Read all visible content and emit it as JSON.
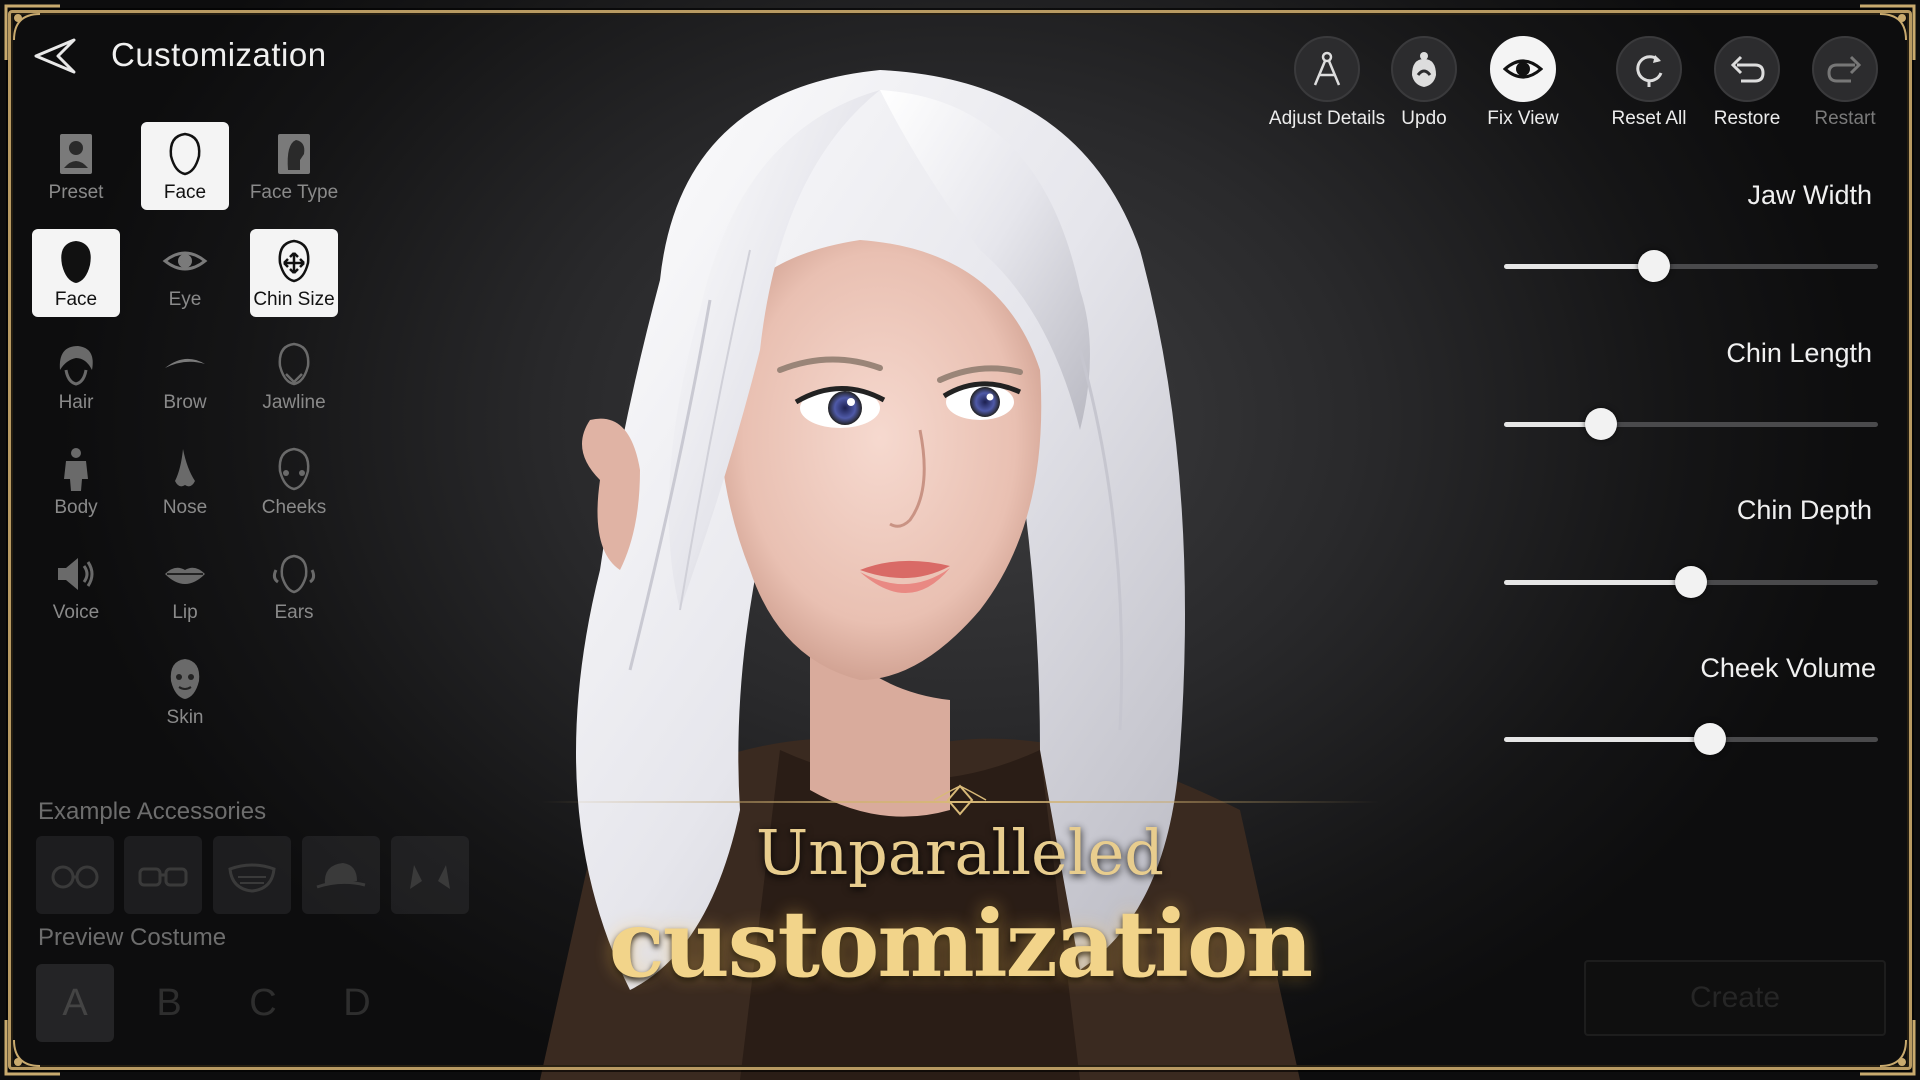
{
  "header": {
    "title": "Customization"
  },
  "categories": [
    {
      "key": "preset",
      "label": "Preset",
      "icon": "portrait-icon",
      "active": false
    },
    {
      "key": "face_tab",
      "label": "Face",
      "icon": "face-outline-icon",
      "active": true
    },
    {
      "key": "face_type",
      "label": "Face Type",
      "icon": "head-profile-icon",
      "active": false
    },
    {
      "key": "face",
      "label": "Face",
      "icon": "face-solid-icon",
      "active": true
    },
    {
      "key": "eye",
      "label": "Eye",
      "icon": "eye-icon",
      "active": false
    },
    {
      "key": "chin_size",
      "label": "Chin Size",
      "icon": "chin-size-icon",
      "active": true
    },
    {
      "key": "hair",
      "label": "Hair",
      "icon": "hair-icon",
      "active": false
    },
    {
      "key": "brow",
      "label": "Brow",
      "icon": "brow-icon",
      "active": false
    },
    {
      "key": "jawline",
      "label": "Jawline",
      "icon": "jawline-icon",
      "active": false
    },
    {
      "key": "body",
      "label": "Body",
      "icon": "body-icon",
      "active": false
    },
    {
      "key": "nose",
      "label": "Nose",
      "icon": "nose-icon",
      "active": false
    },
    {
      "key": "cheeks",
      "label": "Cheeks",
      "icon": "cheeks-icon",
      "active": false
    },
    {
      "key": "voice",
      "label": "Voice",
      "icon": "speaker-icon",
      "active": false
    },
    {
      "key": "lip",
      "label": "Lip",
      "icon": "lip-icon",
      "active": false
    },
    {
      "key": "ears",
      "label": "Ears",
      "icon": "ears-icon",
      "active": false
    },
    {
      "key": "skin",
      "label": "Skin",
      "icon": "skin-icon",
      "active": false
    }
  ],
  "accessories": {
    "label": "Example Accessories",
    "items": [
      "round-glasses-icon",
      "square-glasses-icon",
      "mask-icon",
      "hat-icon",
      "horns-icon"
    ]
  },
  "costume": {
    "label": "Preview Costume",
    "options": [
      "A",
      "B",
      "C",
      "D"
    ],
    "selected": "A"
  },
  "toolbar": [
    {
      "label": "Adjust Details",
      "icon": "compass-icon",
      "state": "normal"
    },
    {
      "label": "Updo",
      "icon": "updo-icon",
      "state": "normal"
    },
    {
      "label": "Fix View",
      "icon": "eye-icon",
      "state": "on"
    },
    {
      "label": "Reset All",
      "icon": "reset-all-icon",
      "state": "normal"
    },
    {
      "label": "Restore",
      "icon": "undo-icon",
      "state": "normal"
    },
    {
      "label": "Restart",
      "icon": "redo-icon",
      "state": "dim"
    }
  ],
  "sliders": [
    {
      "label": "Jaw Width",
      "value": 0.4
    },
    {
      "label": "Chin Length",
      "value": 0.26
    },
    {
      "label": "Chin Depth",
      "value": 0.5
    },
    {
      "label": "Cheek Volume",
      "value": 0.55
    }
  ],
  "create": {
    "label": "Create",
    "enabled": false
  },
  "promo": {
    "line1": "Unparalleled",
    "line2": "customization"
  },
  "colors": {
    "gold": "#b89a62",
    "promo_gold": "#f2d48a",
    "active_tile": "#f4f4f4"
  }
}
